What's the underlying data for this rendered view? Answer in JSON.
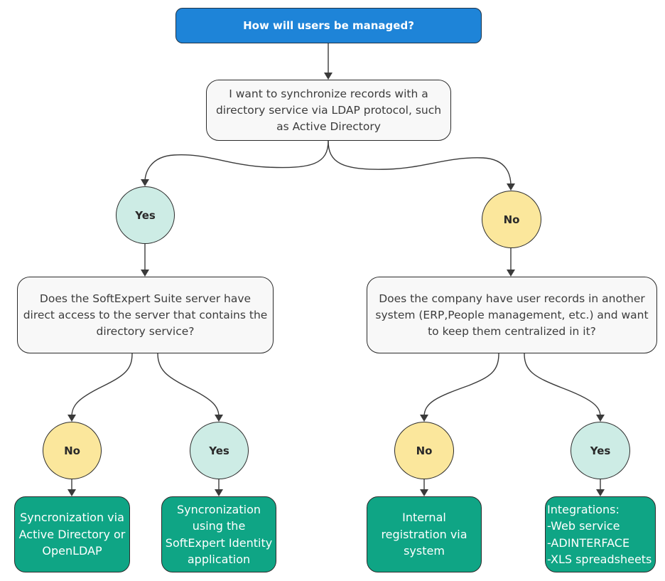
{
  "title": "How will users be managed?",
  "root_question": "I want to synchronize records with a\ndirectory service via LDAP protocol, such\nas Active Directory",
  "branches": {
    "yes": {
      "label": "Yes",
      "question": "Does the SoftExpert Suite server have\ndirect access to the server that contains the\ndirectory service?",
      "no": {
        "label": "No",
        "outcome": "Syncronization via\nActive Directory or\nOpenLDAP"
      },
      "yes": {
        "label": "Yes",
        "outcome": "Syncronization\nusing the\nSoftExpert Identity\napplication"
      }
    },
    "no": {
      "label": "No",
      "question": "Does the company have user records in another\nsystem (ERP,People management, etc.) and want\nto keep them centralized in it?",
      "no": {
        "label": "No",
        "outcome": "Internal\nregistration via\nsystem"
      },
      "yes": {
        "label": "Yes",
        "outcome": "Integrations:\n-Web service\n-ADINTERFACE\n-XLS spreadsheets"
      }
    }
  },
  "colors": {
    "title_fill": "#1e84d8",
    "question_fill": "#f8f8f8",
    "yes_fill": "#cdece5",
    "no_fill": "#fbe79c",
    "outcome_fill": "#0fa585",
    "connector": "#3a3a3a"
  }
}
